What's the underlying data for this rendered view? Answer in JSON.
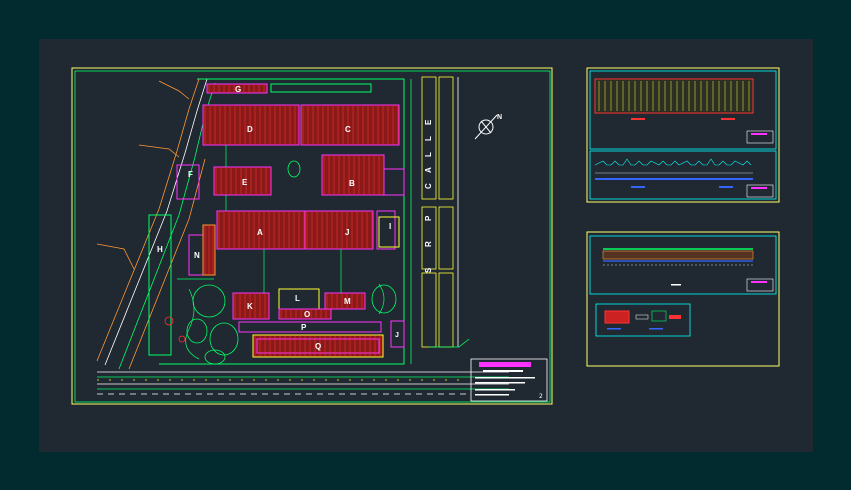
{
  "sheet": {
    "background": "#022b30",
    "paper_color": "#202832",
    "frame_color": "#ffff66",
    "inner_frame_color": "#00ff66"
  },
  "plan": {
    "buildings": [
      "A",
      "B",
      "C",
      "D",
      "E",
      "F",
      "G",
      "H",
      "I",
      "J",
      "K",
      "L",
      "M",
      "N",
      "O",
      "P",
      "Q"
    ],
    "street_letters": [
      "C",
      "A",
      "L",
      "L",
      "E"
    ],
    "street_letters_lower": [
      "P",
      "R",
      "S"
    ],
    "north_label": "N"
  },
  "title_block": {
    "line1": "PROYECTO",
    "line2": "PLANTA GENERAL",
    "sheet_number": "2"
  },
  "detail_sheets": {
    "count": 3,
    "section_colors": [
      "#ff3333",
      "#00ff66",
      "#3366ff",
      "#ffff33",
      "#ff66ff"
    ]
  }
}
